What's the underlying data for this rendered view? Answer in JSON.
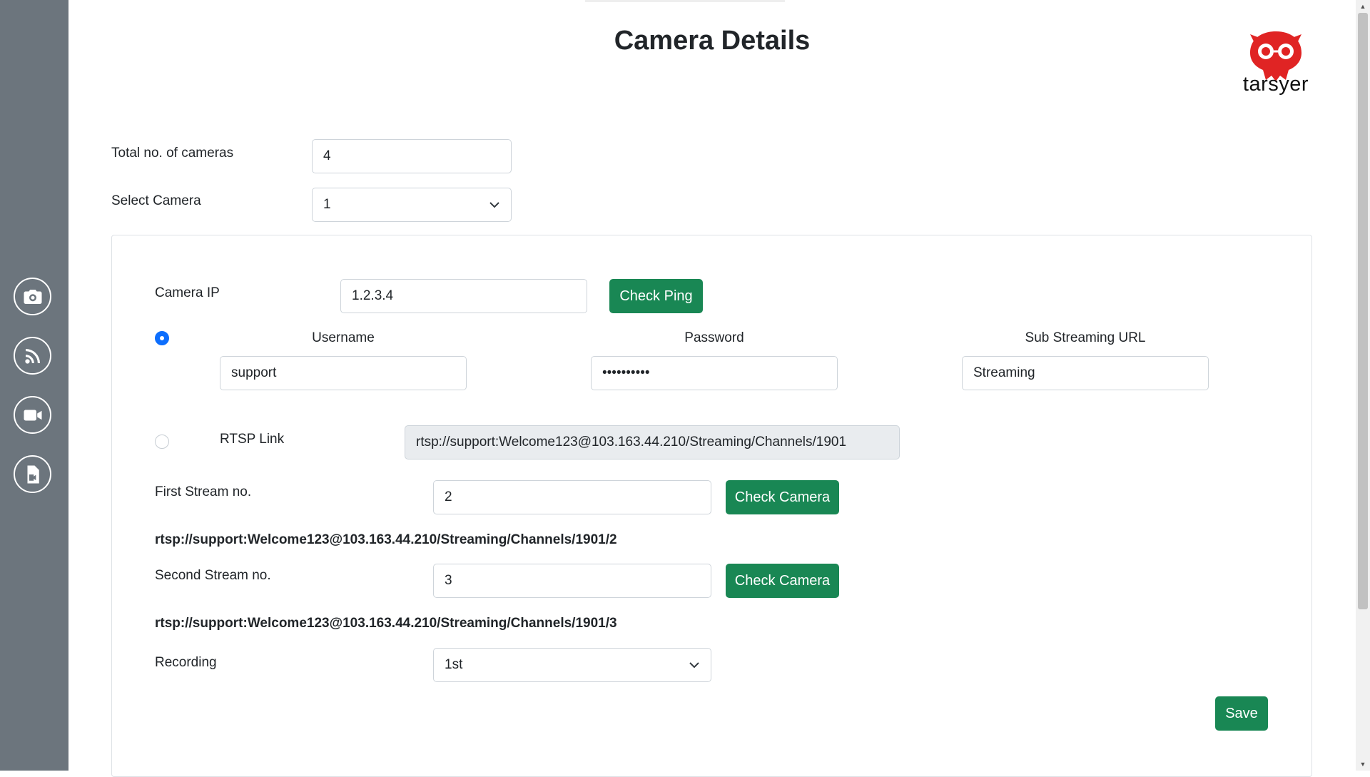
{
  "page": {
    "title": "Camera Details"
  },
  "logo": {
    "text": "tarsyer",
    "primary_color": "#e02424"
  },
  "sidebar": {
    "items": [
      {
        "icon": "camera-icon"
      },
      {
        "icon": "rss-feed-icon"
      },
      {
        "icon": "video-camera-icon"
      },
      {
        "icon": "video-file-icon"
      }
    ]
  },
  "form": {
    "total_cameras": {
      "label": "Total no. of cameras",
      "value": "4"
    },
    "select_camera": {
      "label": "Select Camera",
      "value": "1"
    }
  },
  "camera": {
    "ip": {
      "label": "Camera IP",
      "value": "1.2.3.4"
    },
    "check_ping_label": "Check Ping",
    "credentials_selected": true,
    "username": {
      "label": "Username",
      "value": "support"
    },
    "password": {
      "label": "Password",
      "value": "••••••••••"
    },
    "sub_streaming": {
      "label": "Sub Streaming URL",
      "value": "Streaming"
    },
    "rtsp": {
      "label": "RTSP Link",
      "value": "rtsp://support:Welcome123@103.163.44.210/Streaming/Channels/1901"
    },
    "first_stream": {
      "label": "First Stream no.",
      "value": "2",
      "url": "rtsp://support:Welcome123@103.163.44.210/Streaming/Channels/1901/2"
    },
    "second_stream": {
      "label": "Second Stream no.",
      "value": "3",
      "url": "rtsp://support:Welcome123@103.163.44.210/Streaming/Channels/1901/3"
    },
    "check_camera_label": "Check Camera",
    "recording": {
      "label": "Recording",
      "value": "1st"
    },
    "save_label": "Save"
  },
  "colors": {
    "sidebar": "#6c757d",
    "button": "#198754",
    "radio": "#0d6efd"
  }
}
